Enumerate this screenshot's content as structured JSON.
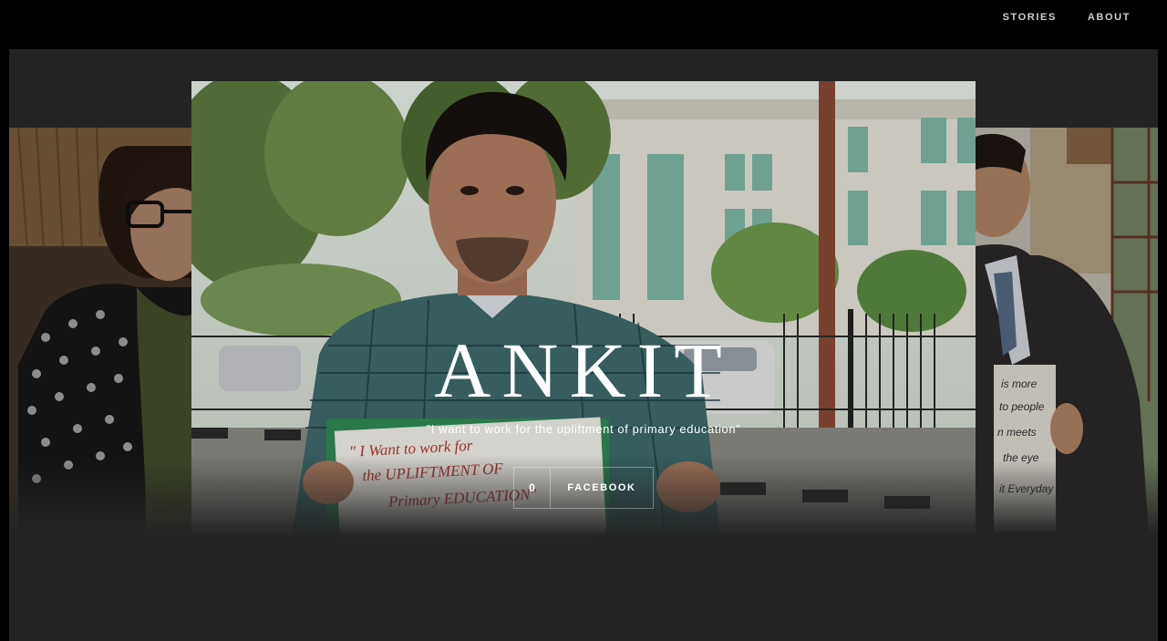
{
  "nav": {
    "items": [
      {
        "label": "STORIES"
      },
      {
        "label": "ABOUT"
      }
    ]
  },
  "hero": {
    "name": "ANKIT",
    "quote": "\"I want to work for the upliftment of primary education\"",
    "share_count": "0",
    "share_label": "FACEBOOK"
  },
  "colors": {
    "page_bg": "#000000",
    "stage_bg": "#232323",
    "text": "#ffffff",
    "nav_text": "#cfcfcf"
  }
}
